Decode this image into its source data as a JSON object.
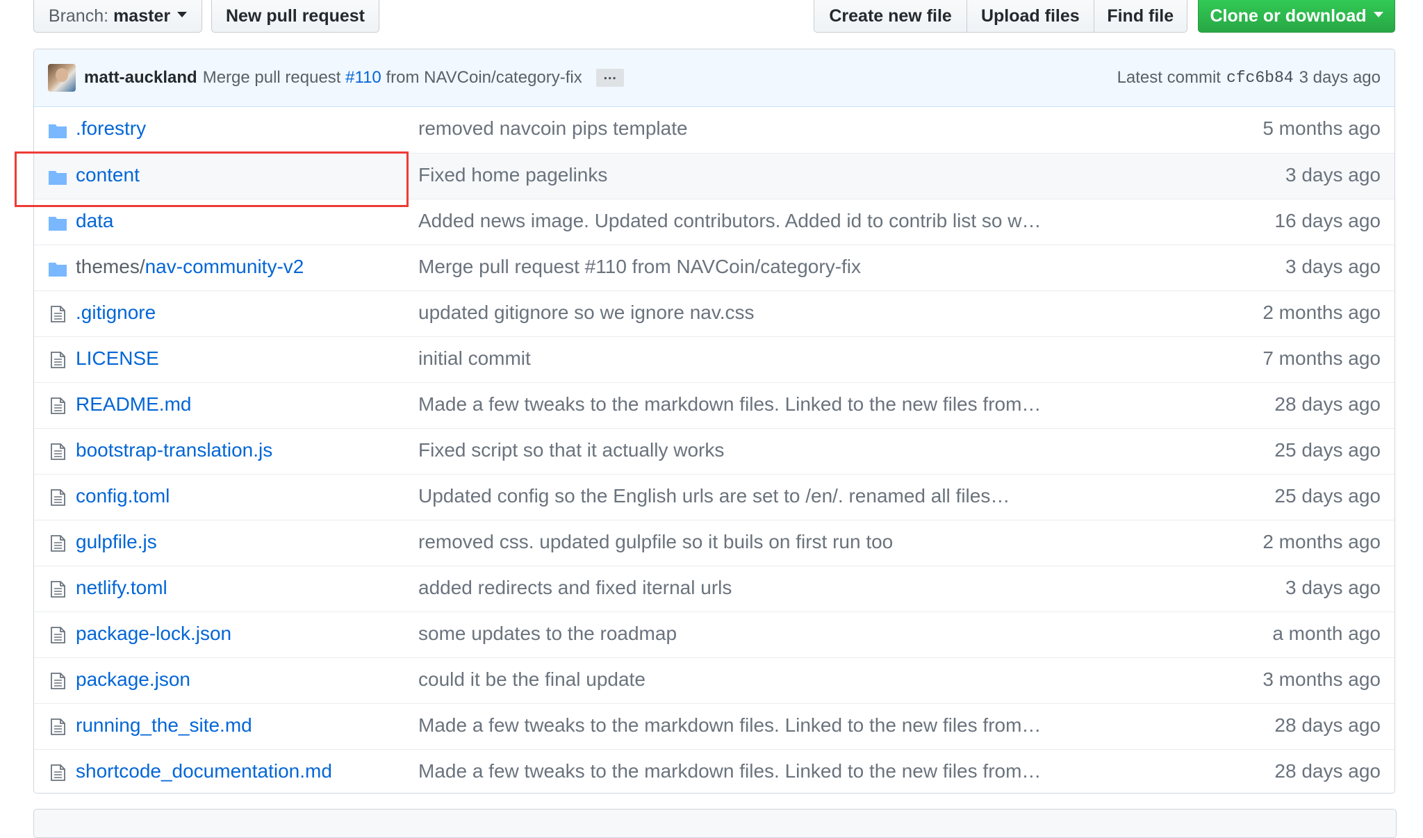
{
  "toolbar": {
    "branch_prefix": "Branch:",
    "branch_name": "master",
    "new_pull_request": "New pull request",
    "create_new_file": "Create new file",
    "upload_files": "Upload files",
    "find_file": "Find file",
    "clone_or_download": "Clone or download"
  },
  "commit": {
    "author": "matt-auckland",
    "message_prefix": "Merge pull request",
    "pr_number": "#110",
    "message_suffix": "from NAVCoin/category-fix",
    "ellipsis": "…",
    "latest_label": "Latest commit",
    "sha": "cfc6b84",
    "age": "3 days ago"
  },
  "files": [
    {
      "type": "folder",
      "name": ".forestry",
      "message": "removed navcoin pips template",
      "age": "5 months ago"
    },
    {
      "type": "folder",
      "name": "content",
      "message": "Fixed home pagelinks",
      "age": "3 days ago",
      "highlighted": true
    },
    {
      "type": "folder",
      "name": "data",
      "message": "Added news image. Updated contributors. Added id to contrib list so w…",
      "age": "16 days ago"
    },
    {
      "type": "folder",
      "prefix": "themes/",
      "name": "nav-community-v2",
      "message": "Merge pull request #110 from NAVCoin/category-fix",
      "age": "3 days ago"
    },
    {
      "type": "file",
      "name": ".gitignore",
      "message": "updated gitignore so we ignore nav.css",
      "age": "2 months ago"
    },
    {
      "type": "file",
      "name": "LICENSE",
      "message": "initial commit",
      "age": "7 months ago"
    },
    {
      "type": "file",
      "name": "README.md",
      "message": "Made a few tweaks to the markdown files. Linked to the new files from…",
      "age": "28 days ago"
    },
    {
      "type": "file",
      "name": "bootstrap-translation.js",
      "message": "Fixed script so that it actually works",
      "age": "25 days ago"
    },
    {
      "type": "file",
      "name": "config.toml",
      "message": "Updated config so the English urls are set to /en/. renamed all files…",
      "age": "25 days ago"
    },
    {
      "type": "file",
      "name": "gulpfile.js",
      "message": "removed css. updated gulpfile so it buils on first run too",
      "age": "2 months ago"
    },
    {
      "type": "file",
      "name": "netlify.toml",
      "message": "added redirects and fixed iternal urls",
      "age": "3 days ago"
    },
    {
      "type": "file",
      "name": "package-lock.json",
      "message": "some updates to the roadmap",
      "age": "a month ago"
    },
    {
      "type": "file",
      "name": "package.json",
      "message": "could it be the final update",
      "age": "3 months ago"
    },
    {
      "type": "file",
      "name": "running_the_site.md",
      "message": "Made a few tweaks to the markdown files. Linked to the new files from…",
      "age": "28 days ago"
    },
    {
      "type": "file",
      "name": "shortcode_documentation.md",
      "message": "Made a few tweaks to the markdown files. Linked to the new files from…",
      "age": "28 days ago"
    }
  ],
  "colors": {
    "link": "#0366d6",
    "commit_bar_bg": "#f1f8ff",
    "clone_button": "#2cbe4e",
    "highlight_box": "#ef3b36",
    "folder_icon": "#79b8ff"
  }
}
